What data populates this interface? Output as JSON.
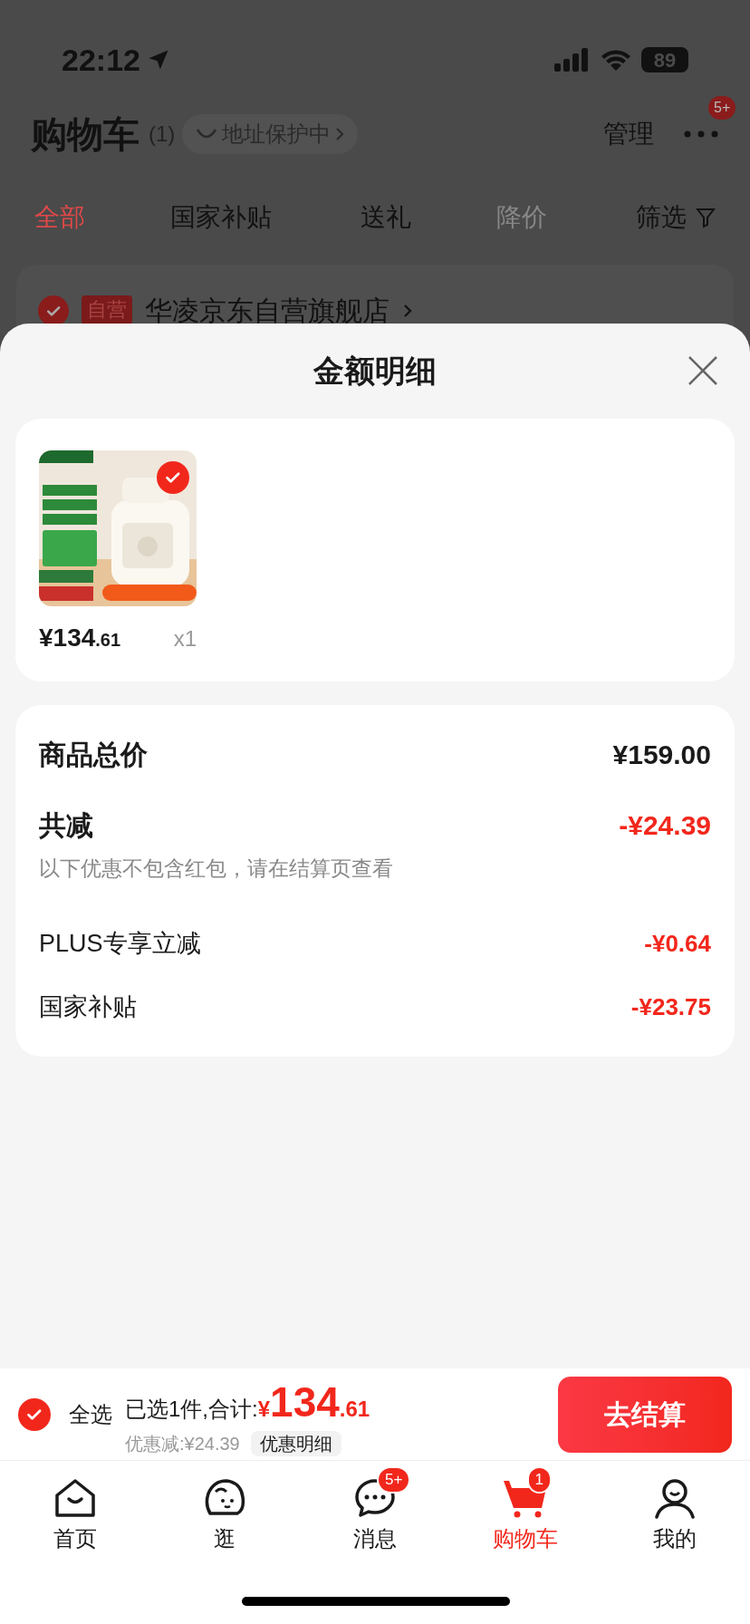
{
  "status_bar": {
    "time": "22:12",
    "battery": "89"
  },
  "header": {
    "title": "购物车",
    "count": "(1)",
    "address_protect": "地址保护中",
    "manage": "管理",
    "more_badge": "5+"
  },
  "tabs": [
    {
      "label": "全部",
      "selected": true,
      "disabled": false
    },
    {
      "label": "国家补贴",
      "selected": false,
      "disabled": false
    },
    {
      "label": "送礼",
      "selected": false,
      "disabled": false
    },
    {
      "label": "降价",
      "selected": false,
      "disabled": true
    }
  ],
  "filter": "筛选",
  "store": {
    "checked": true,
    "tag": "自营",
    "name": "华凌京东自营旗舰店"
  },
  "sheet": {
    "title": "金额明细",
    "items": [
      {
        "kind": "picture",
        "checked": true,
        "price_integer": "¥134",
        "price_decimal": ".61",
        "quantity": "x1"
      }
    ],
    "rows": [
      {
        "kind": "total",
        "label": "商品总价",
        "value": "¥159.00"
      },
      {
        "kind": "discount",
        "label": "共减",
        "value": "-¥24.39",
        "note": "以下优惠不包含红包，请在结算页查看"
      },
      {
        "kind": "detail",
        "label": "PLUS专享立减",
        "value": "-¥0.64"
      },
      {
        "kind": "detail",
        "label": "国家补贴",
        "value": "-¥23.75"
      }
    ]
  },
  "checkout_bar": {
    "select_all_checked": true,
    "select_all": "全选",
    "summary": "已选1件,合计:",
    "total_currency": "¥",
    "total_integer": "134",
    "total_decimal": ".61",
    "discount": "优惠减:¥24.39",
    "details_button": "优惠明细",
    "checkout_button": "去结算"
  },
  "nav": [
    {
      "kind": "home",
      "label": "首页",
      "selected": false
    },
    {
      "kind": "browse",
      "label": "逛",
      "selected": false
    },
    {
      "kind": "message",
      "label": "消息",
      "selected": false,
      "badge": "5+"
    },
    {
      "kind": "cart",
      "label": "购物车",
      "selected": true,
      "badge": "1"
    },
    {
      "kind": "me",
      "label": "我的",
      "selected": false
    }
  ]
}
